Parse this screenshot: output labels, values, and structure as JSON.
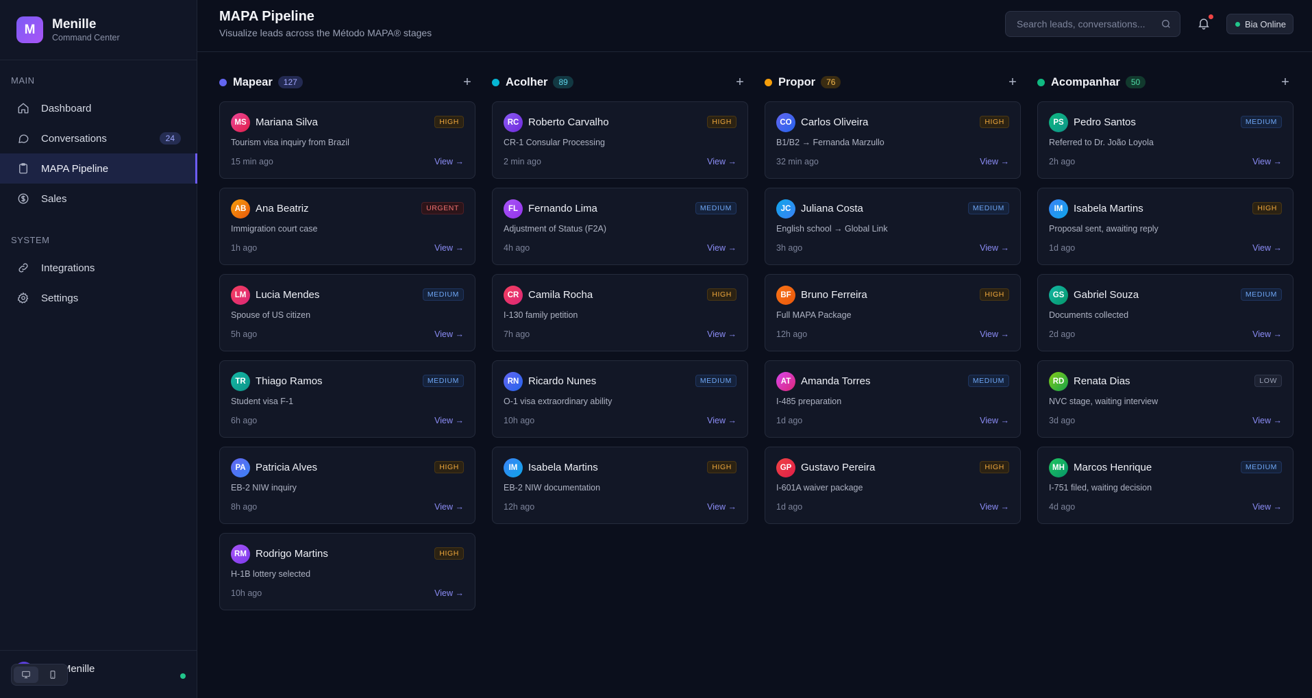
{
  "brand": {
    "logo_letter": "M",
    "name": "Menille",
    "subtitle": "Command Center"
  },
  "sidebar": {
    "section_main": "MAIN",
    "section_system": "SYSTEM",
    "items": [
      {
        "label": "Dashboard",
        "icon": "home-icon"
      },
      {
        "label": "Conversations",
        "icon": "chat-icon",
        "badge": "24"
      },
      {
        "label": "MAPA Pipeline",
        "icon": "clipboard-icon",
        "active": true
      },
      {
        "label": "Sales",
        "icon": "dollar-icon"
      },
      {
        "label": "Integrations",
        "icon": "link-icon"
      },
      {
        "label": "Settings",
        "icon": "gear-icon"
      }
    ],
    "user": {
      "name_visible": "lelle Menille"
    }
  },
  "header": {
    "title": "MAPA Pipeline",
    "subtitle": "Visualize leads across the Método MAPA® stages",
    "search_placeholder": "Search leads, conversations...",
    "status": "Bia Online"
  },
  "colors": {
    "accent": "#6d5cf6",
    "mapear": "#6366f1",
    "acolher": "#06b6d4",
    "propor": "#f59e0b",
    "acompanhar": "#10b981"
  },
  "columns": [
    {
      "name": "Mapear",
      "count": "127",
      "cards": [
        {
          "initials": "MS",
          "name": "Mariana Silva",
          "priority": "HIGH",
          "desc": "Tourism visa inquiry from Brazil",
          "time": "15 min ago",
          "view": "View →"
        },
        {
          "initials": "AB",
          "name": "Ana Beatriz",
          "priority": "URGENT",
          "desc": "Immigration court case",
          "time": "1h ago",
          "view": "View →"
        },
        {
          "initials": "LM",
          "name": "Lucia Mendes",
          "priority": "MEDIUM",
          "desc": "Spouse of US citizen",
          "time": "5h ago",
          "view": "View →"
        },
        {
          "initials": "TR",
          "name": "Thiago Ramos",
          "priority": "MEDIUM",
          "desc": "Student visa F-1",
          "time": "6h ago",
          "view": "View →"
        },
        {
          "initials": "PA",
          "name": "Patricia Alves",
          "priority": "HIGH",
          "desc": "EB-2 NIW inquiry",
          "time": "8h ago",
          "view": "View →"
        },
        {
          "initials": "RM",
          "name": "Rodrigo Martins",
          "priority": "HIGH",
          "desc": "H-1B lottery selected",
          "time": "10h ago",
          "view": "View →"
        }
      ]
    },
    {
      "name": "Acolher",
      "count": "89",
      "cards": [
        {
          "initials": "RC",
          "name": "Roberto Carvalho",
          "priority": "HIGH",
          "desc": "CR-1 Consular Processing",
          "time": "2 min ago",
          "view": "View →"
        },
        {
          "initials": "FL",
          "name": "Fernando Lima",
          "priority": "MEDIUM",
          "desc": "Adjustment of Status (F2A)",
          "time": "4h ago",
          "view": "View →"
        },
        {
          "initials": "CR",
          "name": "Camila Rocha",
          "priority": "HIGH",
          "desc": "I-130 family petition",
          "time": "7h ago",
          "view": "View →"
        },
        {
          "initials": "RN",
          "name": "Ricardo Nunes",
          "priority": "MEDIUM",
          "desc": "O-1 visa extraordinary ability",
          "time": "10h ago",
          "view": "View →"
        },
        {
          "initials": "IM",
          "name": "Isabela Martins",
          "priority": "HIGH",
          "desc": "EB-2 NIW documentation",
          "time": "12h ago",
          "view": "View →"
        }
      ]
    },
    {
      "name": "Propor",
      "count": "76",
      "cards": [
        {
          "initials": "CO",
          "name": "Carlos Oliveira",
          "priority": "HIGH",
          "desc": "B1/B2 → Fernanda Marzullo",
          "time": "32 min ago",
          "view": "View →"
        },
        {
          "initials": "JC",
          "name": "Juliana Costa",
          "priority": "MEDIUM",
          "desc": "English school → Global Link",
          "time": "3h ago",
          "view": "View →"
        },
        {
          "initials": "BF",
          "name": "Bruno Ferreira",
          "priority": "HIGH",
          "desc": "Full MAPA Package",
          "time": "12h ago",
          "view": "View →"
        },
        {
          "initials": "AT",
          "name": "Amanda Torres",
          "priority": "MEDIUM",
          "desc": "I-485 preparation",
          "time": "1d ago",
          "view": "View →"
        },
        {
          "initials": "GP",
          "name": "Gustavo Pereira",
          "priority": "HIGH",
          "desc": "I-601A waiver package",
          "time": "1d ago",
          "view": "View →"
        }
      ]
    },
    {
      "name": "Acompanhar",
      "count": "50",
      "cards": [
        {
          "initials": "PS",
          "name": "Pedro Santos",
          "priority": "MEDIUM",
          "desc": "Referred to Dr. João Loyola",
          "time": "2h ago",
          "view": "View →"
        },
        {
          "initials": "IM",
          "name": "Isabela Martins",
          "priority": "HIGH",
          "desc": "Proposal sent, awaiting reply",
          "time": "1d ago",
          "view": "View →"
        },
        {
          "initials": "GS",
          "name": "Gabriel Souza",
          "priority": "MEDIUM",
          "desc": "Documents collected",
          "time": "2d ago",
          "view": "View →"
        },
        {
          "initials": "RD",
          "name": "Renata Dias",
          "priority": "LOW",
          "desc": "NVC stage, waiting interview",
          "time": "3d ago",
          "view": "View →"
        },
        {
          "initials": "MH",
          "name": "Marcos Henrique",
          "priority": "MEDIUM",
          "desc": "I-751 filed, waiting decision",
          "time": "4d ago",
          "view": "View →"
        }
      ]
    }
  ]
}
